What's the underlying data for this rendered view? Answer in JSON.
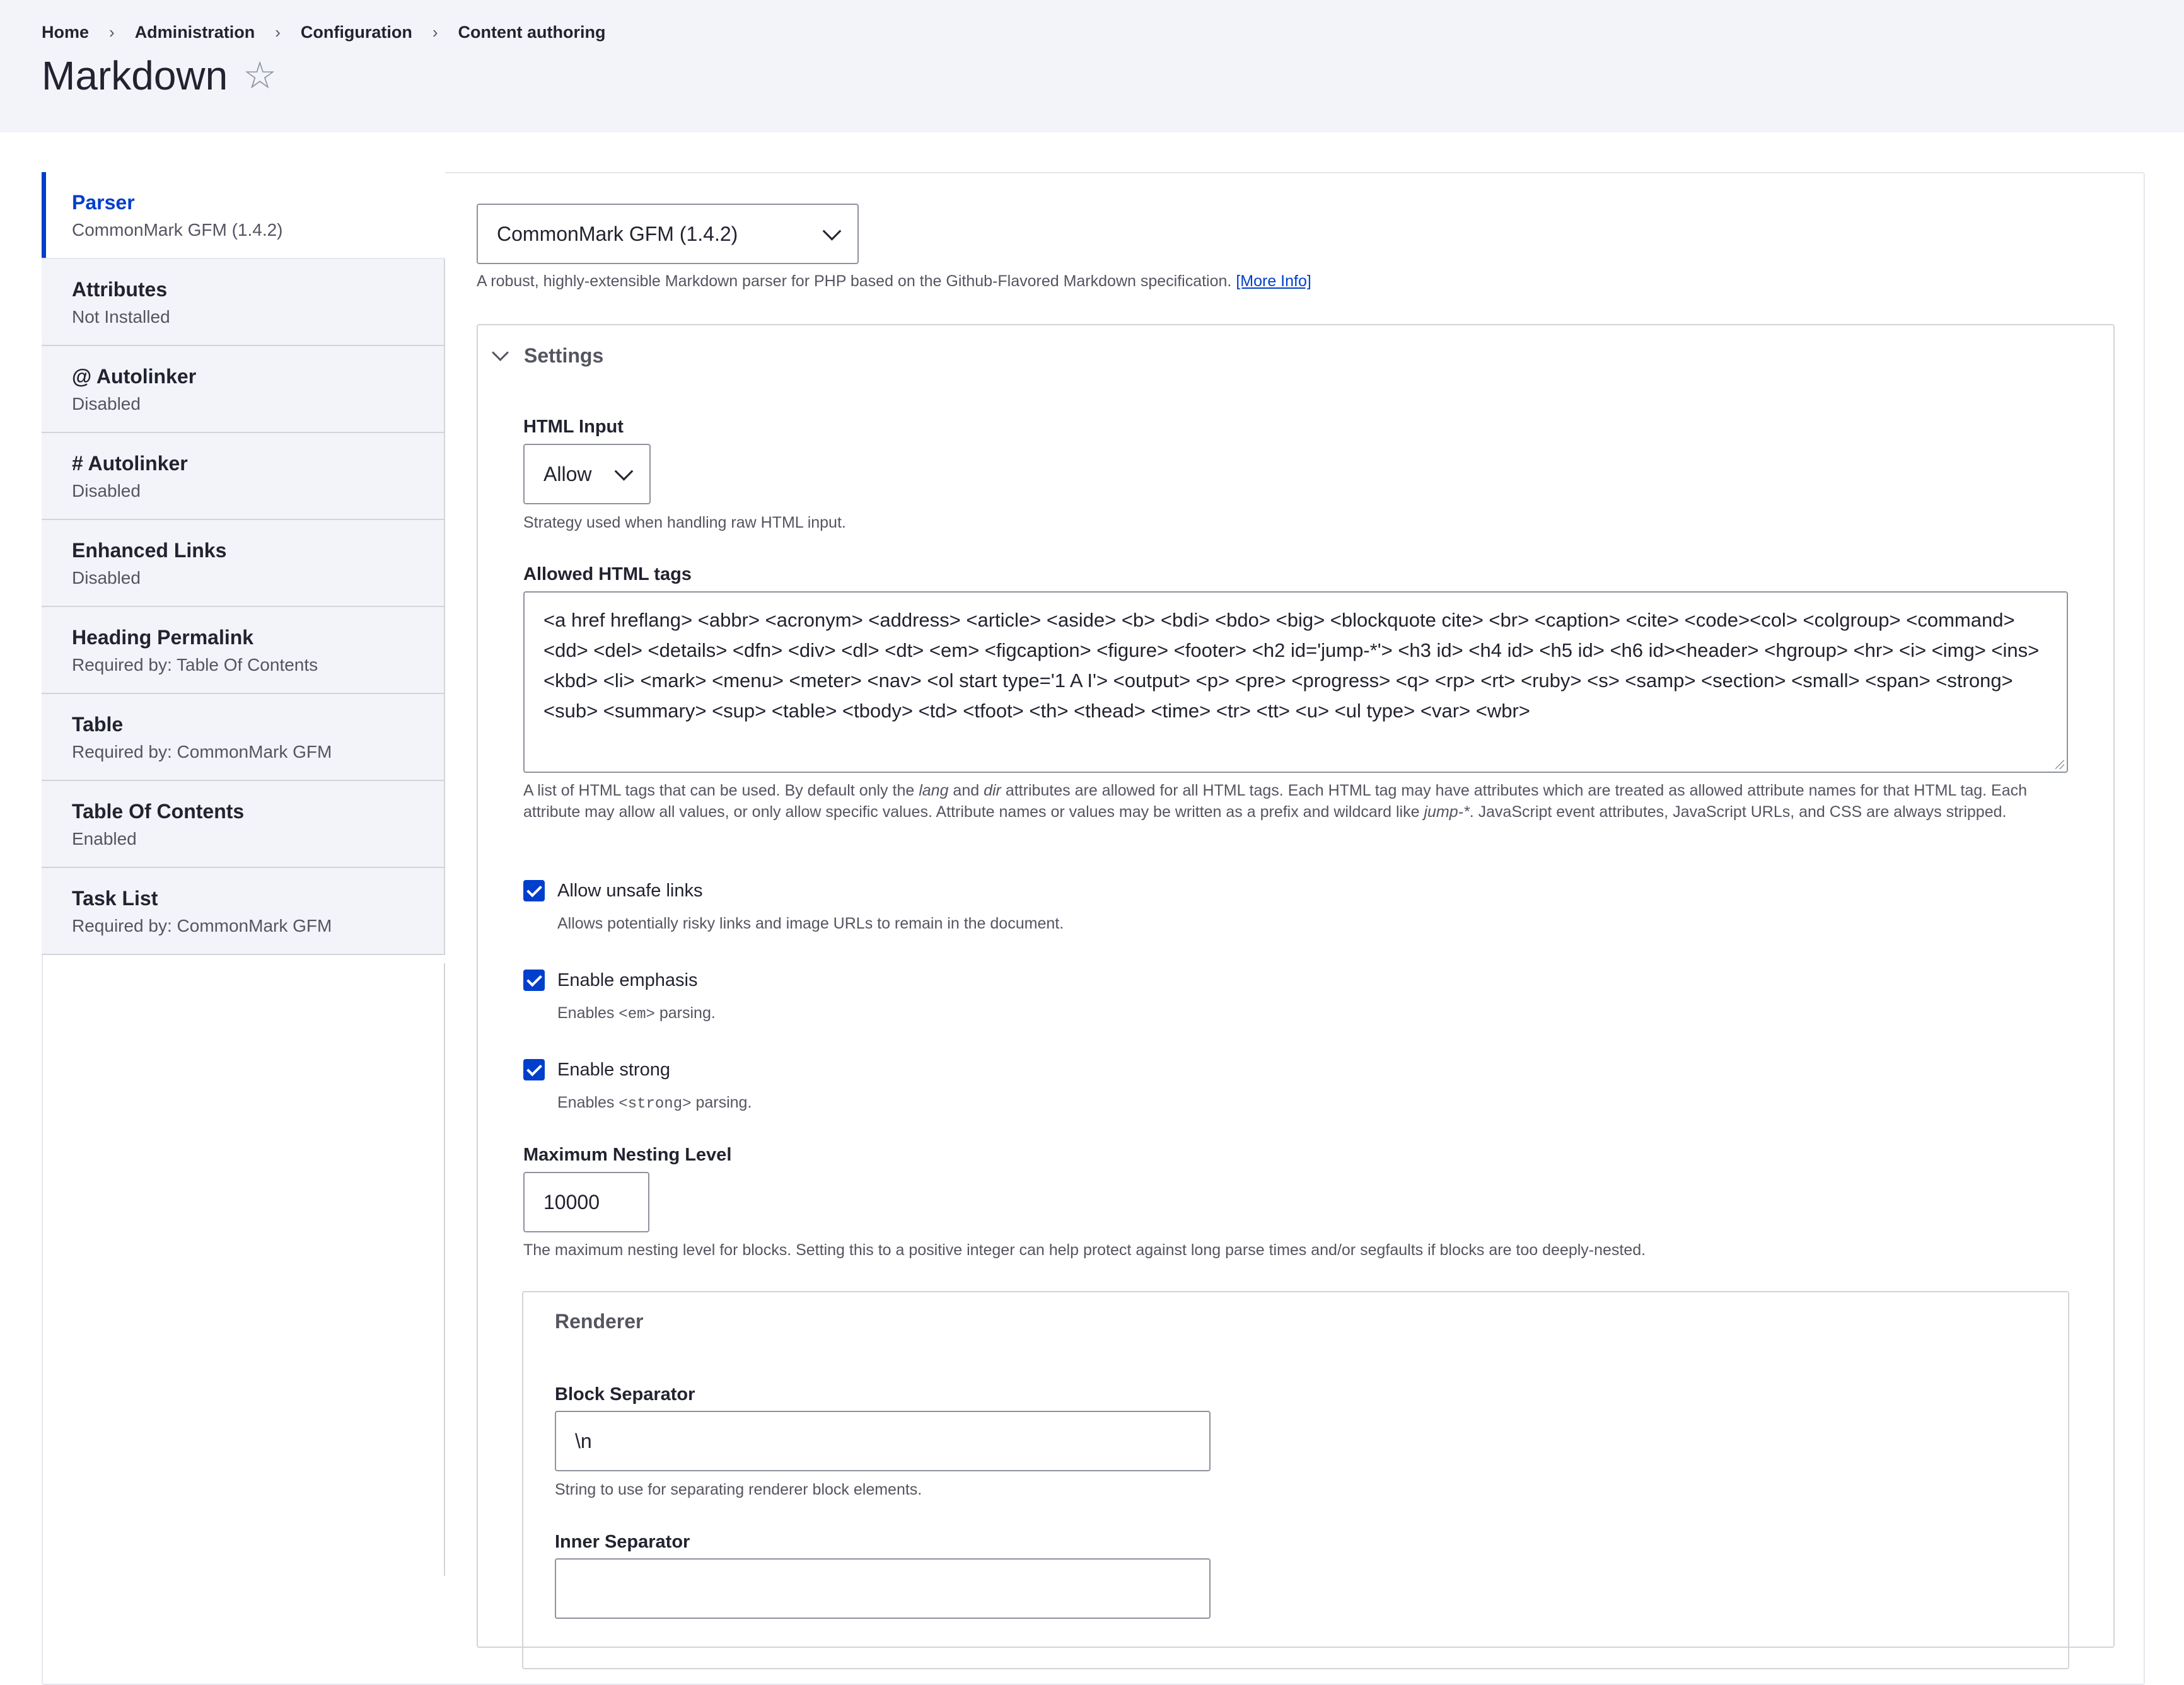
{
  "breadcrumb": [
    "Home",
    "Administration",
    "Configuration",
    "Content authoring"
  ],
  "page_title": "Markdown",
  "star_glyph": "☆",
  "tabs": [
    {
      "title": "Parser",
      "subtitle": "CommonMark GFM (1.4.2)",
      "active": true
    },
    {
      "title": "Attributes",
      "subtitle": "Not Installed"
    },
    {
      "title": "@ Autolinker",
      "subtitle": "Disabled"
    },
    {
      "title": "# Autolinker",
      "subtitle": "Disabled"
    },
    {
      "title": "Enhanced Links",
      "subtitle": "Disabled"
    },
    {
      "title": "Heading Permalink",
      "subtitle": "Required by: Table Of Contents"
    },
    {
      "title": "Table",
      "subtitle": "Required by: CommonMark GFM"
    },
    {
      "title": "Table Of Contents",
      "subtitle": "Enabled"
    },
    {
      "title": "Task List",
      "subtitle": "Required by: CommonMark GFM"
    }
  ],
  "parser": {
    "selected": "CommonMark GFM (1.4.2)",
    "description": "A robust, highly-extensible Markdown parser for PHP based on the Github-Flavored Markdown specification.",
    "more_info": "[More Info]"
  },
  "settings": {
    "summary": "Settings",
    "html_input": {
      "label": "HTML Input",
      "selected": "Allow",
      "description": "Strategy used when handling raw HTML input."
    },
    "allowed_tags": {
      "label": "Allowed HTML tags",
      "value": "<a href hreflang> <abbr> <acronym> <address> <article> <aside> <b> <bdi> <bdo> <big> <blockquote cite> <br> <caption> <cite> <code><col> <colgroup> <command> <dd> <del> <details> <dfn> <div> <dl> <dt> <em> <figcaption> <figure> <footer> <h2 id='jump-*'> <h3 id> <h4 id> <h5 id> <h6 id><header> <hgroup> <hr> <i> <img> <ins> <kbd> <li> <mark> <menu> <meter> <nav> <ol start type='1 A I'> <output> <p> <pre> <progress> <q> <rp> <rt> <ruby> <s> <samp> <section> <small> <span> <strong> <sub> <summary> <sup> <table> <tbody> <td> <tfoot> <th> <thead> <time> <tr> <tt> <u> <ul type> <var> <wbr>",
      "desc_1": "A list of HTML tags that can be used. By default only the ",
      "desc_lang": "lang",
      "desc_2": " and ",
      "desc_dir": "dir",
      "desc_3": " attributes are allowed for all HTML tags. Each HTML tag may have attributes which are treated as allowed attribute names for that HTML tag. Each attribute may allow all values, or only allow specific values. Attribute names or values may be written as a prefix and wildcard like ",
      "desc_jump": "jump-*",
      "desc_4": ". JavaScript event attributes, JavaScript URLs, and CSS are always stripped."
    },
    "unsafe_links": {
      "label": "Allow unsafe links",
      "checked": true,
      "description": "Allows potentially risky links and image URLs to remain in the document."
    },
    "emphasis": {
      "label": "Enable emphasis",
      "checked": true,
      "desc_pre": "Enables ",
      "desc_code": "<em>",
      "desc_post": " parsing."
    },
    "strong": {
      "label": "Enable strong",
      "checked": true,
      "desc_pre": "Enables ",
      "desc_code": "<strong>",
      "desc_post": " parsing."
    },
    "nesting": {
      "label": "Maximum Nesting Level",
      "value": "10000",
      "description": "The maximum nesting level for blocks. Setting this to a positive integer can help protect against long parse times and/or segfaults if blocks are too deeply-nested."
    },
    "renderer": {
      "legend": "Renderer",
      "block_separator": {
        "label": "Block Separator",
        "value": "\\n",
        "description": "String to use for separating renderer block elements."
      },
      "inner_separator": {
        "label": "Inner Separator"
      }
    }
  },
  "colors": {
    "accent": "#003ecc",
    "header_bg": "#f3f4f9",
    "text": "#222330",
    "muted": "#545560"
  }
}
